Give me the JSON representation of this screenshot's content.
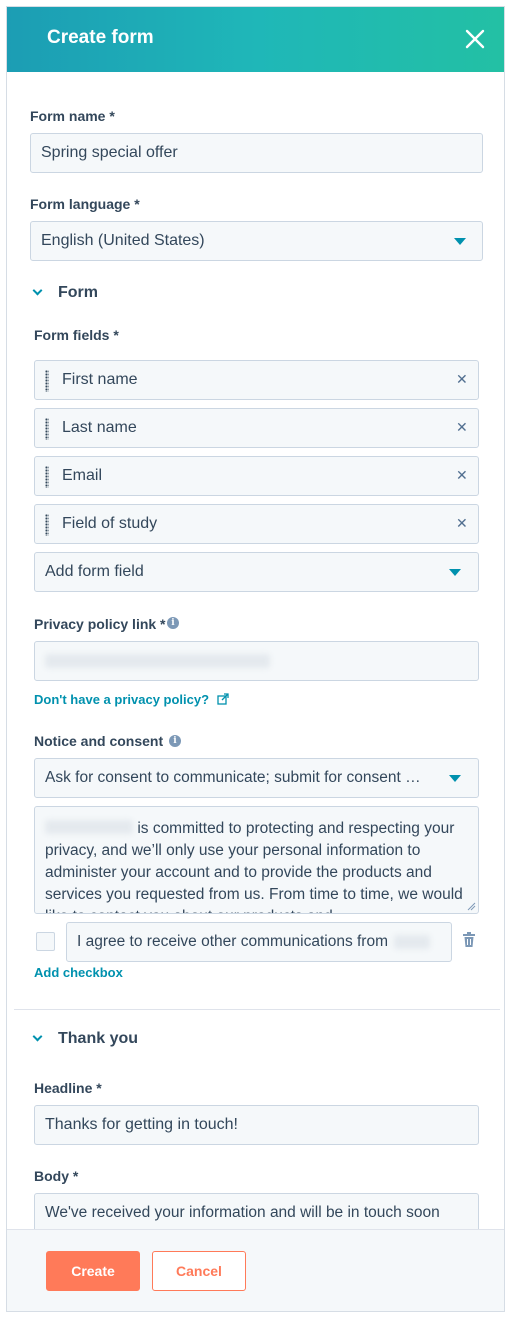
{
  "header": {
    "title": "Create form"
  },
  "form_name": {
    "label": "Form name *",
    "value": "Spring special offer"
  },
  "form_language": {
    "label": "Form language *",
    "value": "English (United States)"
  },
  "form_section": {
    "title": "Form",
    "fields_label": "Form fields *",
    "fields": [
      {
        "label": "First name"
      },
      {
        "label": "Last name"
      },
      {
        "label": "Email"
      },
      {
        "label": "Field of study"
      }
    ],
    "add_field": "Add form field"
  },
  "privacy": {
    "label": "Privacy policy link *",
    "no_policy_link": "Don't have a privacy policy?"
  },
  "consent": {
    "label": "Notice and consent",
    "dropdown_value": "Ask for consent to communicate; submit for consent …",
    "text": "is committed to protecting and respecting your privacy, and we’ll only use your personal information to administer your account and to provide the products and services you requested from us. From time to time, we would like to contact you about our products and",
    "checkbox_text": "I agree to receive other communications from",
    "add_checkbox": "Add checkbox"
  },
  "thank_you": {
    "title": "Thank you",
    "headline_label": "Headline *",
    "headline_value": "Thanks for getting in touch!",
    "body_label": "Body *",
    "body_value": "We've received your information and will be in touch soon"
  },
  "footer": {
    "create_label": "Create",
    "cancel_label": "Cancel"
  },
  "colors": {
    "accent": "#0091ae",
    "primary_button": "#ff7a59",
    "header_start": "#1c9db4",
    "header_end": "#23c0a4"
  }
}
